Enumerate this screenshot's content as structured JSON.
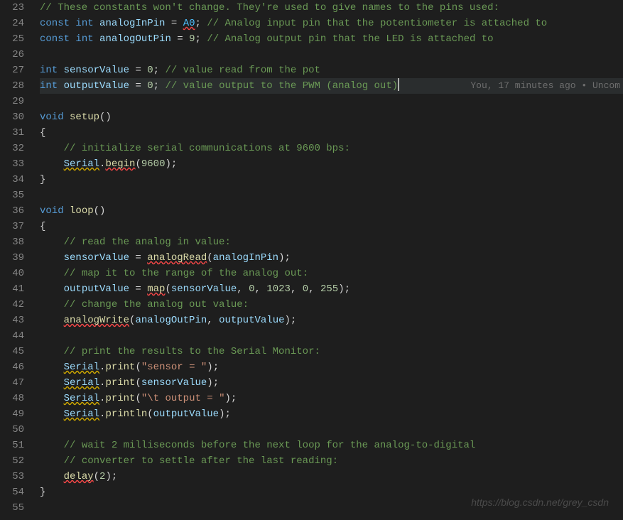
{
  "lineStart": 23,
  "lineEnd": 55,
  "highlightLine": 28,
  "codelens": "You, 17 minutes ago • Uncom",
  "watermark": "https://blog.csdn.net/grey_csdn",
  "tokens": {
    "l23": {
      "comment": "// These constants won't change. They're used to give names to the pins used:"
    },
    "l24": {
      "kw1": "const",
      "kw2": "int",
      "id": "analogInPin",
      "eq": " = ",
      "val": "A0",
      "semi": ";",
      "comment": " // Analog input pin that the potentiometer is attached to"
    },
    "l25": {
      "kw1": "const",
      "kw2": "int",
      "id": "analogOutPin",
      "eq": " = ",
      "val": "9",
      "semi": ";",
      "comment": " // Analog output pin that the LED is attached to"
    },
    "l27": {
      "kw": "int",
      "id": "sensorValue",
      "eq": " = ",
      "val": "0",
      "semi": ";",
      "comment": " // value read from the pot"
    },
    "l28": {
      "kw": "int",
      "id": "outputValue",
      "eq": " = ",
      "val": "0",
      "semi": ";",
      "comment": " // value output to the PWM (analog out)"
    },
    "l30": {
      "kw": "void",
      "fn": "setup",
      "paren": "()"
    },
    "l31": {
      "brace": "{"
    },
    "l32": {
      "indent": "    ",
      "comment": "// initialize serial communications at 9600 bps:"
    },
    "l33": {
      "indent": "    ",
      "obj": "Serial",
      "dot": ".",
      "fn": "begin",
      "open": "(",
      "arg": "9600",
      "close": ")",
      "semi": ";"
    },
    "l34": {
      "brace": "}"
    },
    "l36": {
      "kw": "void",
      "fn": "loop",
      "paren": "()"
    },
    "l37": {
      "brace": "{"
    },
    "l38": {
      "indent": "    ",
      "comment": "// read the analog in value:"
    },
    "l39": {
      "indent": "    ",
      "id": "sensorValue",
      "eq": " = ",
      "fn": "analogRead",
      "open": "(",
      "arg": "analogInPin",
      "close": ")",
      "semi": ";"
    },
    "l40": {
      "indent": "    ",
      "comment": "// map it to the range of the analog out:"
    },
    "l41": {
      "indent": "    ",
      "id": "outputValue",
      "eq": " = ",
      "fn": "map",
      "open": "(",
      "a1": "sensorValue",
      "c1": ", ",
      "a2": "0",
      "c2": ", ",
      "a3": "1023",
      "c3": ", ",
      "a4": "0",
      "c4": ", ",
      "a5": "255",
      "close": ")",
      "semi": ";"
    },
    "l42": {
      "indent": "    ",
      "comment": "// change the analog out value:"
    },
    "l43": {
      "indent": "    ",
      "fn": "analogWrite",
      "open": "(",
      "a1": "analogOutPin",
      "c1": ", ",
      "a2": "outputValue",
      "close": ")",
      "semi": ";"
    },
    "l45": {
      "indent": "    ",
      "comment": "// print the results to the Serial Monitor:"
    },
    "l46": {
      "indent": "    ",
      "obj": "Serial",
      "dot": ".",
      "fn": "print",
      "open": "(",
      "str": "\"sensor = \"",
      "close": ")",
      "semi": ";"
    },
    "l47": {
      "indent": "    ",
      "obj": "Serial",
      "dot": ".",
      "fn": "print",
      "open": "(",
      "arg": "sensorValue",
      "close": ")",
      "semi": ";"
    },
    "l48": {
      "indent": "    ",
      "obj": "Serial",
      "dot": ".",
      "fn": "print",
      "open": "(",
      "str": "\"\\t output = \"",
      "close": ")",
      "semi": ";"
    },
    "l49": {
      "indent": "    ",
      "obj": "Serial",
      "dot": ".",
      "fn": "println",
      "open": "(",
      "arg": "outputValue",
      "close": ")",
      "semi": ";"
    },
    "l51": {
      "indent": "    ",
      "comment": "// wait 2 milliseconds before the next loop for the analog-to-digital"
    },
    "l52": {
      "indent": "    ",
      "comment": "// converter to settle after the last reading:"
    },
    "l53": {
      "indent": "    ",
      "fn": "delay",
      "open": "(",
      "arg": "2",
      "close": ")",
      "semi": ";"
    },
    "l54": {
      "brace": "}"
    }
  }
}
